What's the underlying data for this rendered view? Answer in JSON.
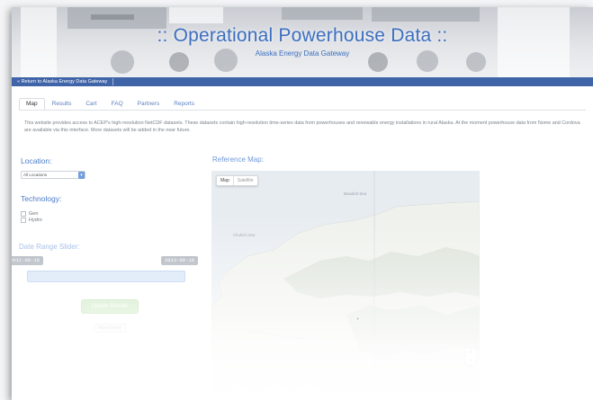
{
  "header": {
    "title": ":: Operational Powerhouse Data ::",
    "subtitle": "Alaska Energy Data Gateway"
  },
  "return_link": "« Return to Alaska Energy Data Gateway",
  "tabs": [
    {
      "label": "Map",
      "active": true
    },
    {
      "label": "Results"
    },
    {
      "label": "Cart"
    },
    {
      "label": "FAQ"
    },
    {
      "label": "Partners"
    },
    {
      "label": "Reports"
    }
  ],
  "intro": "This website provides access to ACEP's high-resolution NetCDF datasets. These datasets contain high-resolution time-series data from powerhouses and renewable energy installations in rural Alaska. At the moment powerhouse data from Nome and Cordova are available via this interface. More datasets will be added in the near future.",
  "location": {
    "label": "Location:",
    "selected": "All Locations"
  },
  "technology": {
    "label": "Technology:",
    "options": [
      "Gen",
      "Hydro"
    ]
  },
  "date_range": {
    "label": "Date Range Slider:",
    "start": "2012-09-18",
    "end": "2013-09-18"
  },
  "buttons": {
    "update": "Update Results",
    "reset": "Reset Form"
  },
  "map": {
    "label": "Reference Map:",
    "toggle_map": "Map",
    "toggle_sat": "Satellite",
    "labels": {
      "beaufort_sea": "Beaufort Sea",
      "chukchi_sea": "Chukchi Sea"
    },
    "zoom_in": "+",
    "zoom_out": "−"
  },
  "colors": {
    "accent": "#3d6fc0",
    "return_bar": "#3f64a8",
    "update_button": "#bfe3b3"
  }
}
